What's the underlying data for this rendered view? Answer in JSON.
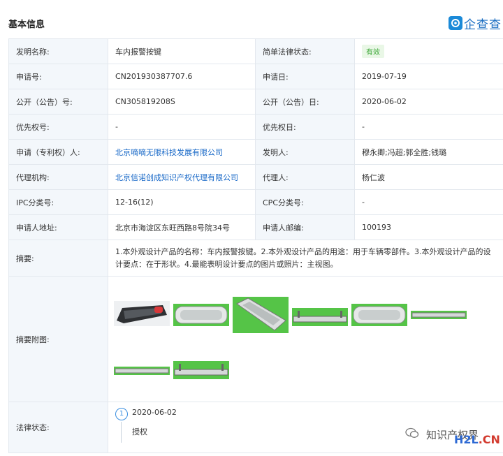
{
  "header": {
    "section_title": "基本信息",
    "logo_text": "企查查"
  },
  "rows": {
    "r1": {
      "l1": "发明名称:",
      "v1": "车内报警按键",
      "l2": "简单法律状态:",
      "v2": "有效"
    },
    "r2": {
      "l1": "申请号:",
      "v1": "CN201930387707.6",
      "l2": "申请日:",
      "v2": "2019-07-19"
    },
    "r3": {
      "l1": "公开（公告）号:",
      "v1": "CN305819208S",
      "l2": "公开（公告）日:",
      "v2": "2020-06-02"
    },
    "r4": {
      "l1": "优先权号:",
      "v1": "-",
      "l2": "优先权日:",
      "v2": "-"
    },
    "r5": {
      "l1": "申请（专利权）人:",
      "v1": "北京嘀嘀无限科技发展有限公司",
      "l2": "发明人:",
      "v2": "穆永卿;冯超;郭全胜;钱璐"
    },
    "r6": {
      "l1": "代理机构:",
      "v1": "北京信诺创成知识产权代理有限公司",
      "l2": "代理人:",
      "v2": "杨仁波"
    },
    "r7": {
      "l1": "IPC分类号:",
      "v1": "12-16(12)",
      "l2": "CPC分类号:",
      "v2": "-"
    },
    "r8": {
      "l1": "申请人地址:",
      "v1": "北京市海淀区东旺西路8号院34号",
      "l2": "申请人邮编:",
      "v2": "100193"
    }
  },
  "abstract": {
    "label": "摘要:",
    "text": "1.本外观设计产品的名称：车内报警按键。2.本外观设计产品的用途：用于车辆零部件。3.本外观设计产品的设计要点：在于形状。4.最能表明设计要点的图片或照片：主视图。"
  },
  "figures": {
    "label": "摘要附图:"
  },
  "legal": {
    "label": "法律状态:",
    "step_number": "1",
    "date": "2020-06-02",
    "status": "授权"
  },
  "watermark": {
    "text": "知识产权界",
    "site_h2l": "H2L",
    "site_cn": ".CN"
  },
  "colors": {
    "link": "#1667c7",
    "badge_green": "#3fa83a",
    "figure_green": "#55c447",
    "label_bg": "#f3f7fb"
  }
}
